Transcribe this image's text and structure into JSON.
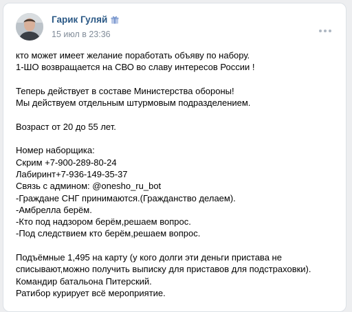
{
  "post": {
    "author_name": "Гарик Гуляй",
    "timestamp": "15 июл в 23:36",
    "icons": {
      "avatar": "user-avatar-photo",
      "badge": "gift-icon",
      "menu": "more-horizontal-icon"
    },
    "colors": {
      "author": "#2a5885",
      "timestamp": "#818c99",
      "text": "#000000",
      "background": "#edeef0"
    },
    "paragraphs": [
      {
        "lines": [
          "кто может имеет желание поработать объяву по набору.",
          "1-ШО возвращается на СВО во славу интересов России !"
        ]
      },
      {
        "lines": [
          "Теперь действует в составе Министерства обороны!",
          "Мы действуем отдельным штурмовым подразделением."
        ]
      },
      {
        "lines": [
          "Возраст от 20 до 55 лет."
        ]
      },
      {
        "lines": [
          "Номер наборщика:",
          "Скрим +7-900-289-80-24",
          "Лабиринт+7-936-149-35-37",
          "Связь с админом: @onesho_ru_bot",
          "-Граждане СНГ принимаются.(Гражданство делаем).",
          "-Амбрелла берём.",
          "-Кто под надзором берём,решаем вопрос.",
          "-Под следствием кто берём,решаем вопрос."
        ]
      },
      {
        "lines": [
          "Подъёмные 1,495 на карту (у кого долги эти деньги пристава не списывают,можно получить выписку для приставов для подстраховки).",
          "Командир батальона Питерский.",
          "Ратибор курирует всё мероприятие."
        ]
      }
    ]
  }
}
